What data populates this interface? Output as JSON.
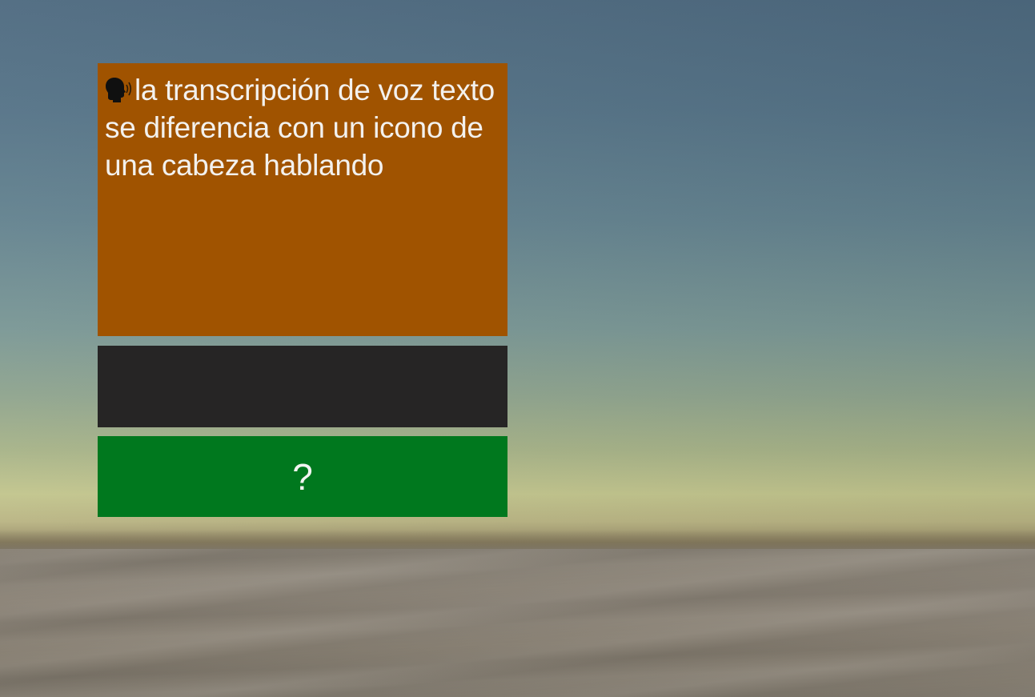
{
  "caption_panel": {
    "icon": "speaking-head-icon",
    "text": "la transcripción de voz texto se diferencia con un icono de una cabeza hablando",
    "background": "#a05300",
    "text_color": "#f3f1ee"
  },
  "status_panel": {
    "background": "#262525"
  },
  "help_button": {
    "label": "?",
    "background": "#00781e"
  },
  "scene": {
    "sky_top": "#4e6a80",
    "sky_horizon": "#c2c58d",
    "ground": "#8b8478"
  }
}
